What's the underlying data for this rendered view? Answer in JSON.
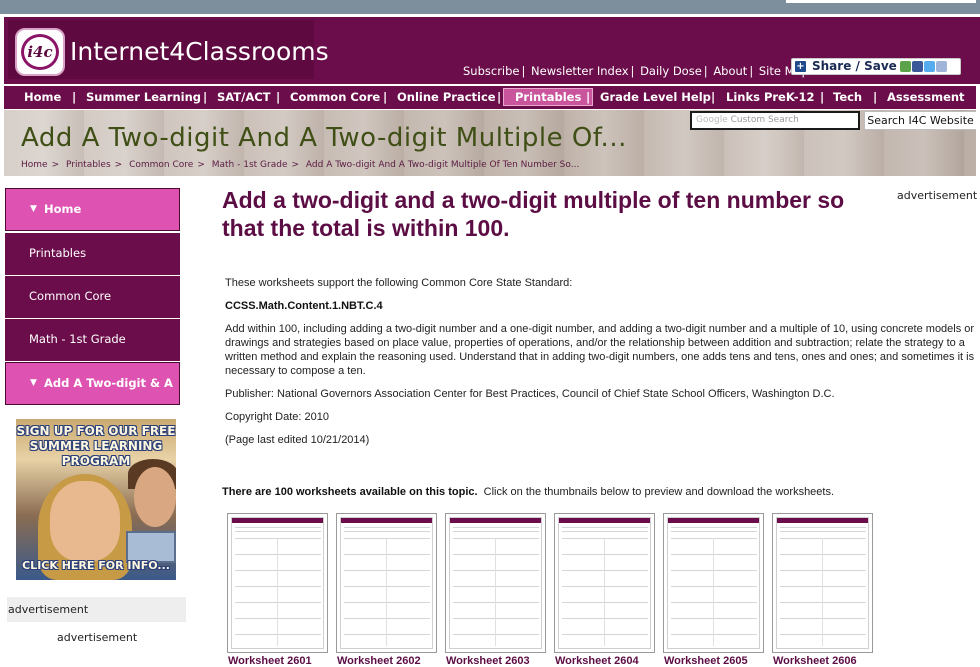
{
  "site": {
    "logo_mark": "i4c",
    "name": "Internet4Classrooms"
  },
  "top_links": [
    "Subscribe",
    "Newsletter Index",
    "Daily Dose",
    "About",
    "Site Map"
  ],
  "share": {
    "label": "Share / Save"
  },
  "nav": {
    "items": [
      "Home",
      "Summer Learning",
      "SAT/ACT",
      "Common Core",
      "Online Practice",
      "Printables",
      "Grade Level Help",
      "Links PreK-12",
      "Tech",
      "Assessment"
    ],
    "active": "Printables"
  },
  "banner": {
    "title": "Add A Two-digit And A Two-digit Multiple Of...",
    "breadcrumb": [
      "Home",
      "Printables",
      "Common Core",
      "Math - 1st Grade",
      "Add A Two-digit And A Two-digit Multiple Of Ten Number So..."
    ],
    "breadcrumb_sep": ">"
  },
  "search": {
    "placeholder": "Custom Search",
    "google_label": "Google",
    "button": "Search I4C Website"
  },
  "sidebar": {
    "items": [
      {
        "label": "Home",
        "highlight": true
      },
      {
        "label": "Printables",
        "highlight": false
      },
      {
        "label": "Common Core",
        "highlight": false
      },
      {
        "label": "Math - 1st Grade",
        "highlight": false
      },
      {
        "label": "Add A Two-digit & A",
        "highlight": true
      }
    ],
    "promo_title": "SIGN UP FOR OUR FREE SUMMER LEARNING PROGRAM",
    "promo_cta": "CLICK HERE FOR INFO...",
    "ad_label": "advertisement",
    "ad_label2": "advertisement"
  },
  "ad_right": "advertisement",
  "main": {
    "title": "Add a two-digit and a two-digit multiple of ten number so that the total is within 100.",
    "intro": "These worksheets support the following Common Core State Standard:",
    "standard_code": "CCSS.Math.Content.1.NBT.C.4",
    "description": "Add within 100, including adding a two-digit number and a one-digit number, and adding a two-digit number and a multiple of 10, using concrete models or drawings and strategies based on place value, properties of operations, and/or the relationship between addition and subtraction; relate the strategy to a written method and explain the reasoning used. Understand that in adding two-digit numbers, one adds tens and tens, ones and ones; and sometimes it is necessary to compose a ten.",
    "publisher": "Publisher: National Governors Association Center for Best Practices, Council of Chief State School Officers, Washington D.C.",
    "copyright": "Copyright Date: 2010",
    "edited": "(Page last edited 10/21/2014)",
    "count_bold": "There are 100 worksheets available on this topic.",
    "count_rest": "Click on the thumbnails below to preview and download the worksheets."
  },
  "worksheets": [
    "Worksheet 2601",
    "Worksheet 2602",
    "Worksheet 2603",
    "Worksheet 2604",
    "Worksheet 2605",
    "Worksheet 2606"
  ],
  "colors": {
    "brand": "#6b0d4a",
    "highlight": "#de52b2",
    "title": "#5b0d44"
  }
}
